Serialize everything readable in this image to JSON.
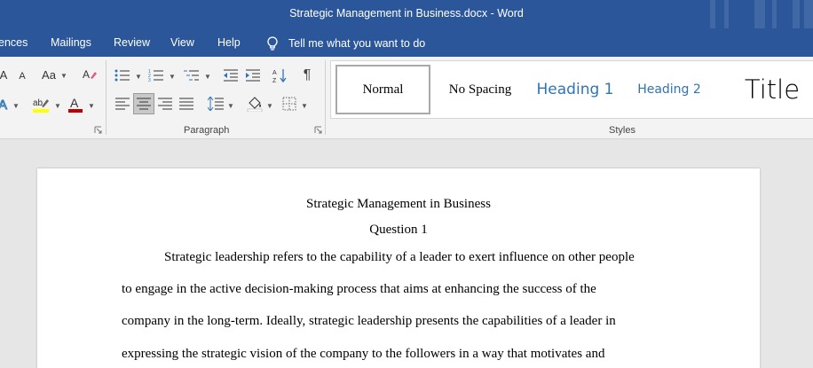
{
  "window": {
    "title": "Strategic Management in Business.docx  -  Word"
  },
  "tabs": [
    {
      "label": "ences"
    },
    {
      "label": "Mailings"
    },
    {
      "label": "Review"
    },
    {
      "label": "View"
    },
    {
      "label": "Help"
    }
  ],
  "tell_me": {
    "text": "Tell me what you want to do",
    "icon": "lightbulb-icon"
  },
  "ribbon": {
    "font_group": {
      "grow_font_label": "A",
      "shrink_font_label": "A",
      "change_case_label": "Aa",
      "text_effects_label": "A",
      "font_color": "#c00000",
      "highlight_color": "#ffff00"
    },
    "paragraph_group": {
      "label": "Paragraph",
      "active_alignment": "center"
    },
    "styles_group": {
      "label": "Styles",
      "items": [
        {
          "label": "Normal",
          "selected": true
        },
        {
          "label": "No Spacing"
        },
        {
          "label": "Heading 1"
        },
        {
          "label": "Heading 2"
        },
        {
          "label": "Title"
        }
      ]
    },
    "accent_color": "#2e74b5"
  },
  "document": {
    "title": "Strategic Management in Business",
    "subtitle": "Question 1",
    "lines": [
      "Strategic leadership refers to the capability of a leader to exert influence on other people",
      "to engage in the active decision-making process that aims at enhancing the success of the",
      "company in the long-term. Ideally, strategic leadership presents the capabilities of a leader in",
      "expressing the strategic vision of the company to the followers in a way that motivates and"
    ]
  },
  "colors": {
    "title_bar": "#2b579a",
    "ribbon": "#f3f3f3",
    "canvas": "#e6e6e6"
  }
}
